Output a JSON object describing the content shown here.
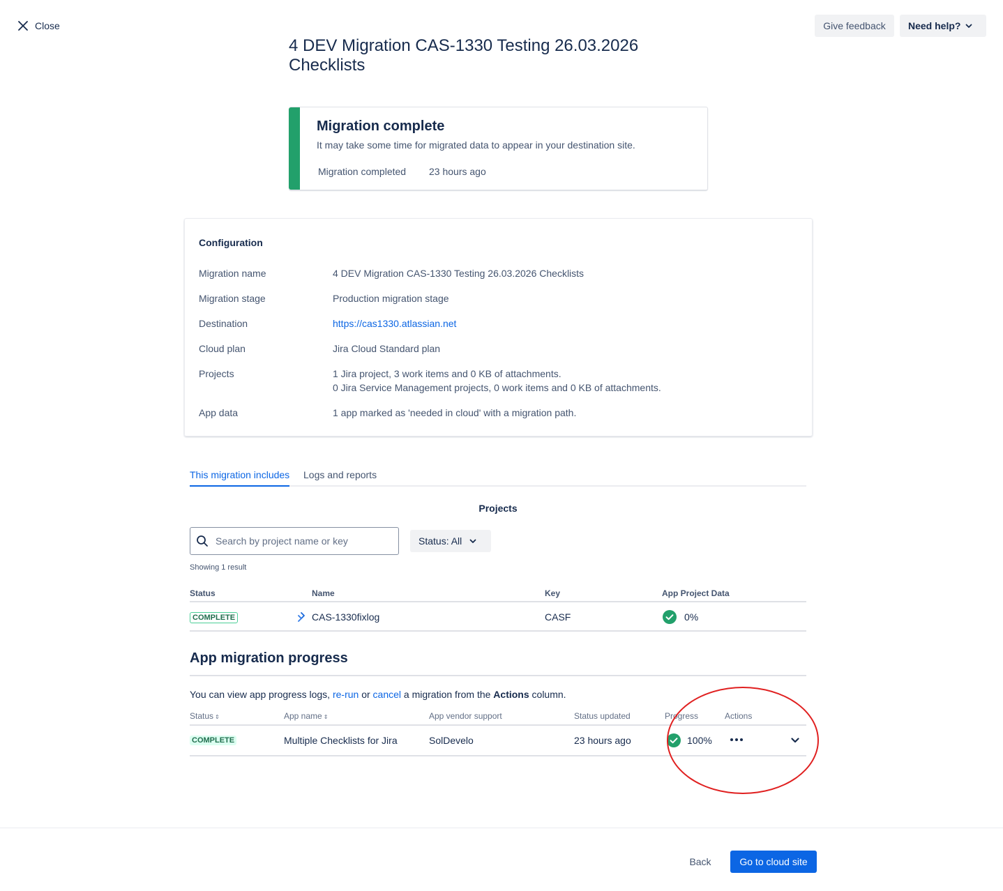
{
  "header": {
    "close_label": "Close",
    "feedback_label": "Give feedback",
    "help_label": "Need help?"
  },
  "page_title": "4 DEV Migration CAS-1330 Testing 26.03.2026 Checklists",
  "banner": {
    "title": "Migration complete",
    "description": "It may take some time for migrated data to appear in your destination site.",
    "completed_label": "Migration completed",
    "completed_value": "23 hours ago",
    "accent_color": "#22a06b"
  },
  "configuration": {
    "title": "Configuration",
    "rows": [
      {
        "label": "Migration name",
        "value": "4 DEV Migration CAS-1330 Testing 26.03.2026 Checklists"
      },
      {
        "label": "Migration stage",
        "value": "Production migration stage"
      },
      {
        "label": "Destination",
        "value": "https://cas1330.atlassian.net"
      },
      {
        "label": "Cloud plan",
        "value": "Jira Cloud Standard plan"
      },
      {
        "label": "Projects",
        "value": "1 Jira project, 3 work items and 0 KB of attachments.",
        "value2": "0 Jira Service Management projects, 0 work items and 0 KB of attachments."
      },
      {
        "label": "App data",
        "value": "1 app marked as 'needed in cloud' with a migration path."
      }
    ]
  },
  "tabs": [
    {
      "label": "This migration includes",
      "active": true
    },
    {
      "label": "Logs and reports",
      "active": false
    }
  ],
  "projects": {
    "section_title": "Projects",
    "search_placeholder": "Search by project name or key",
    "status_filter": "Status: All",
    "showing": "Showing 1 result",
    "columns": [
      "Status",
      "Name",
      "Key",
      "App Project Data"
    ],
    "rows": [
      {
        "status": "COMPLETE",
        "name": "CAS-1330fixlog",
        "key": "CASF",
        "app_data": "0%"
      }
    ]
  },
  "apps": {
    "title": "App migration progress",
    "intro": {
      "prefix": "You can view app progress logs, ",
      "rerun": "re-run",
      "or": " or ",
      "cancel": "cancel",
      "middle": " a migration from the ",
      "actions": "Actions",
      "suffix": " column."
    },
    "columns": [
      "Status",
      "App name",
      "App vendor support",
      "Status updated",
      "Progress",
      "Actions"
    ],
    "rows": [
      {
        "status": "COMPLETE",
        "app_name": "Multiple Checklists for Jira",
        "vendor": "SolDevelo",
        "updated": "23 hours ago",
        "progress": "100%"
      }
    ]
  },
  "footer": {
    "back_label": "Back",
    "primary_label": "Go to cloud site"
  },
  "colors": {
    "primary": "#0c66e4",
    "success": "#22a06b",
    "annotation": "#e02020"
  }
}
